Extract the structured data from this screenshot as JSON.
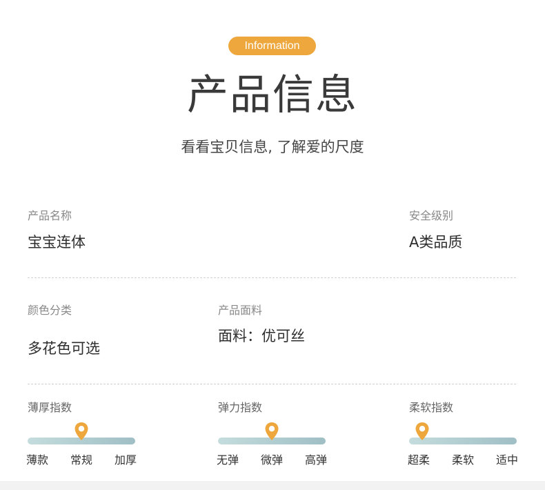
{
  "header": {
    "badge": "Information",
    "title": "产品信息",
    "subtitle": "看看宝贝信息, 了解爱的尺度"
  },
  "fields": {
    "product_name": {
      "label": "产品名称",
      "value": "宝宝连体"
    },
    "safety_level": {
      "label": "安全级别",
      "value": "A类品质"
    },
    "colors": {
      "label": "颜色分类",
      "value": "多花色可选"
    },
    "fabric": {
      "label": "产品面料",
      "value": "面料：优可丝"
    }
  },
  "scales": [
    {
      "label": "薄厚指数",
      "options": [
        "薄款",
        "常规",
        "加厚"
      ],
      "selected_fraction": 0.5
    },
    {
      "label": "弹力指数",
      "options": [
        "无弹",
        "微弹",
        "高弹"
      ],
      "selected_fraction": 0.5
    },
    {
      "label": "柔软指数",
      "options": [
        "超柔",
        "柔软",
        "适中"
      ],
      "selected_fraction": 0.12
    }
  ],
  "colors": {
    "accent": "#eea73c",
    "bar_start": "#c4dcdd",
    "bar_end": "#9fbfc5"
  },
  "icons": {
    "marker": "location-pin-icon"
  }
}
